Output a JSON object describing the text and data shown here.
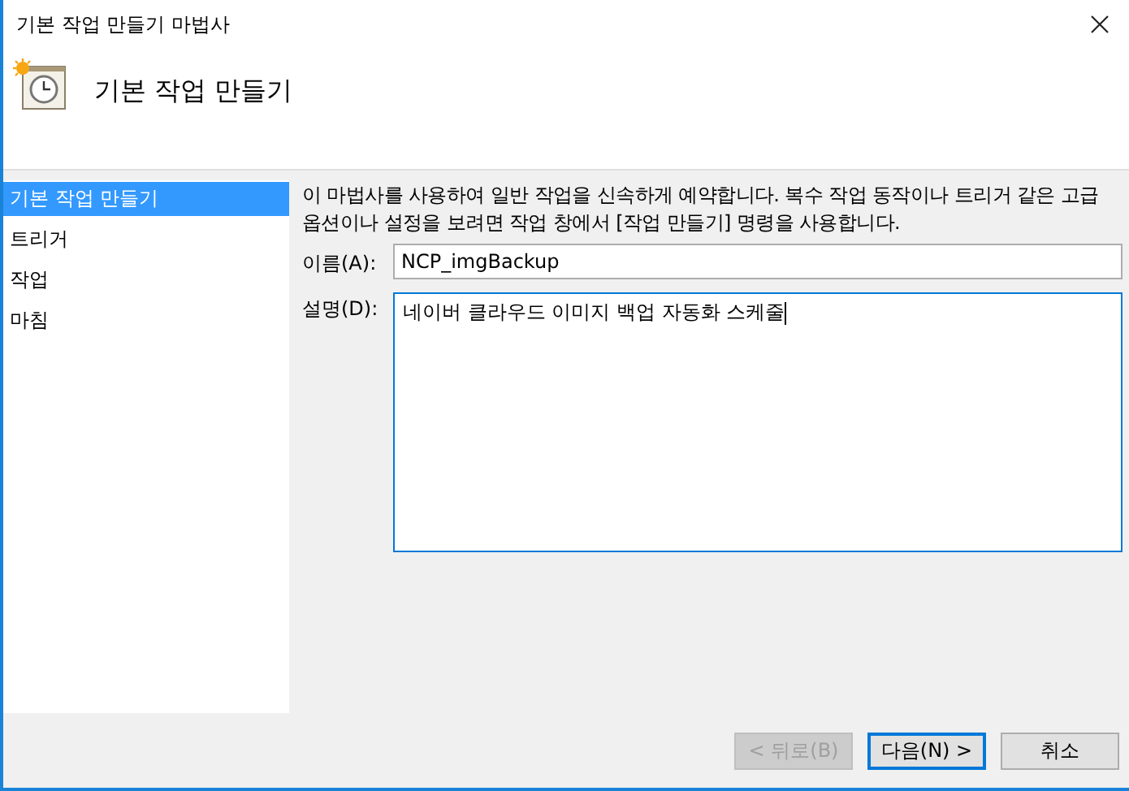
{
  "window": {
    "title": "기본 작업 만들기 마법사"
  },
  "header": {
    "title": "기본 작업 만들기"
  },
  "sidebar": {
    "items": [
      {
        "label": "기본 작업 만들기",
        "selected": true
      },
      {
        "label": "트리거",
        "selected": false
      },
      {
        "label": "작업",
        "selected": false
      },
      {
        "label": "마침",
        "selected": false
      }
    ]
  },
  "intro": "이 마법사를 사용하여 일반 작업을 신속하게 예약합니다. 복수 작업 동작이나 트리거 같은 고급 옵션이나 설정을 보려면 작업 창에서 [작업 만들기] 명령을 사용합니다.",
  "form": {
    "name_label": "이름(A):",
    "name_value": "NCP_imgBackup",
    "description_label": "설명(D):",
    "description_value": "네이버 클라우드 이미지 백업 자동화 스케줄"
  },
  "buttons": [
    {
      "label": "< 뒤로(B)",
      "disabled": true,
      "focused": false
    },
    {
      "label": "다음(N) >",
      "disabled": false,
      "focused": true
    },
    {
      "label": "취소",
      "disabled": false,
      "focused": false
    }
  ]
}
